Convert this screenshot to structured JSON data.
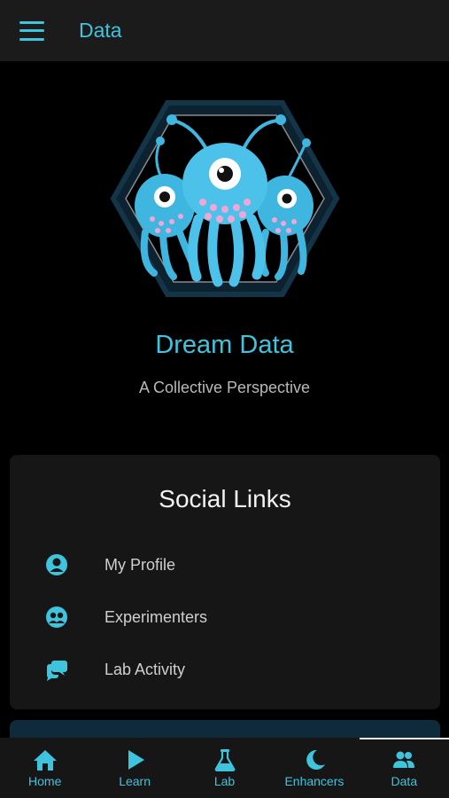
{
  "appbar": {
    "title": "Data",
    "menu_icon": "hamburger-menu-icon"
  },
  "hero": {
    "logo": "alien-trio-hexagon-logo",
    "title": "Dream Data",
    "subtitle": "A Collective Perspective"
  },
  "social": {
    "title": "Social Links",
    "items": [
      {
        "label": "My Profile",
        "icon": "user-circle-icon"
      },
      {
        "label": "Experimenters",
        "icon": "users-circle-icon"
      },
      {
        "label": "Lab Activity",
        "icon": "chat-bubbles-icon"
      }
    ]
  },
  "bottom_nav": {
    "active": "Data",
    "items": [
      {
        "label": "Home",
        "icon": "home-icon"
      },
      {
        "label": "Learn",
        "icon": "play-icon"
      },
      {
        "label": "Lab",
        "icon": "flask-icon"
      },
      {
        "label": "Enhancers",
        "icon": "moon-icon"
      },
      {
        "label": "Data",
        "icon": "people-icon"
      }
    ]
  },
  "colors": {
    "accent": "#3fc4de",
    "background": "#000000",
    "card": "#161616"
  }
}
